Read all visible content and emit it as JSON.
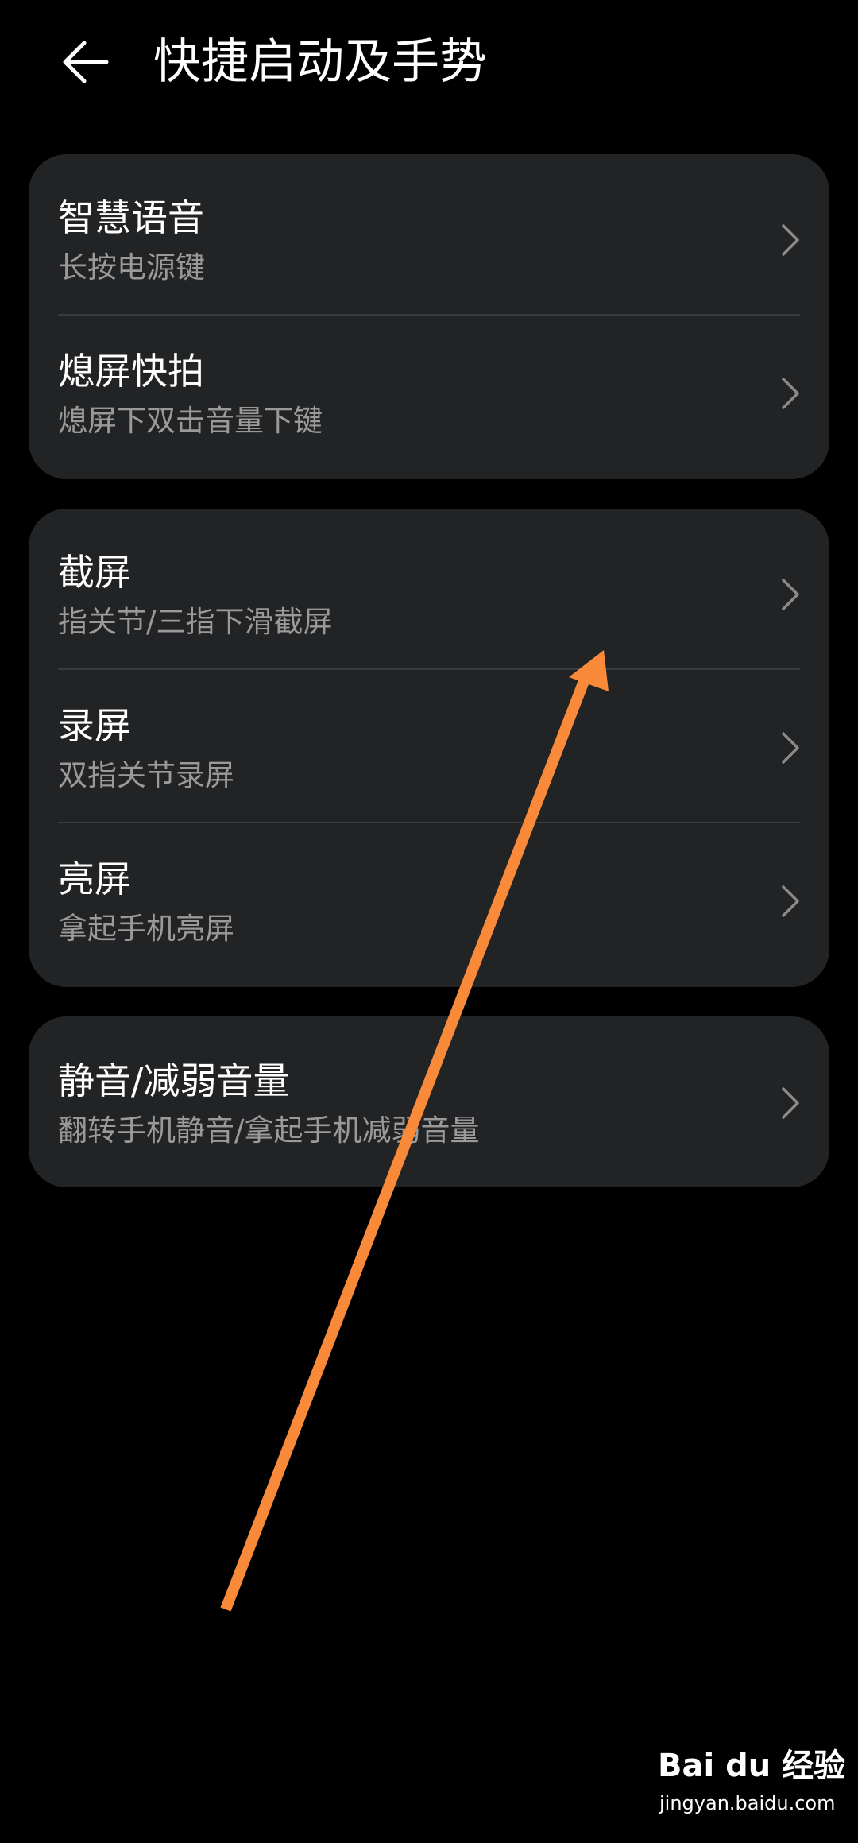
{
  "header": {
    "title": "快捷启动及手势",
    "back_icon": "arrow-left-icon"
  },
  "groups": [
    {
      "items": [
        {
          "title": "智慧语音",
          "subtitle": "长按电源键"
        },
        {
          "title": "熄屏快拍",
          "subtitle": "熄屏下双击音量下键"
        }
      ]
    },
    {
      "items": [
        {
          "title": "截屏",
          "subtitle": "指关节/三指下滑截屏"
        },
        {
          "title": "录屏",
          "subtitle": "双指关节录屏"
        },
        {
          "title": "亮屏",
          "subtitle": "拿起手机亮屏"
        }
      ]
    },
    {
      "items": [
        {
          "title": "静音/减弱音量",
          "subtitle": "翻转手机静音/拿起手机减弱音量"
        }
      ]
    }
  ],
  "colors": {
    "background": "#000000",
    "card": "#222325",
    "subtitle": "#9a9a9a",
    "annotation_arrow": "#f98a3a"
  },
  "watermark": {
    "logo": "Bai du 经验",
    "url": "jingyan.baidu.com"
  }
}
